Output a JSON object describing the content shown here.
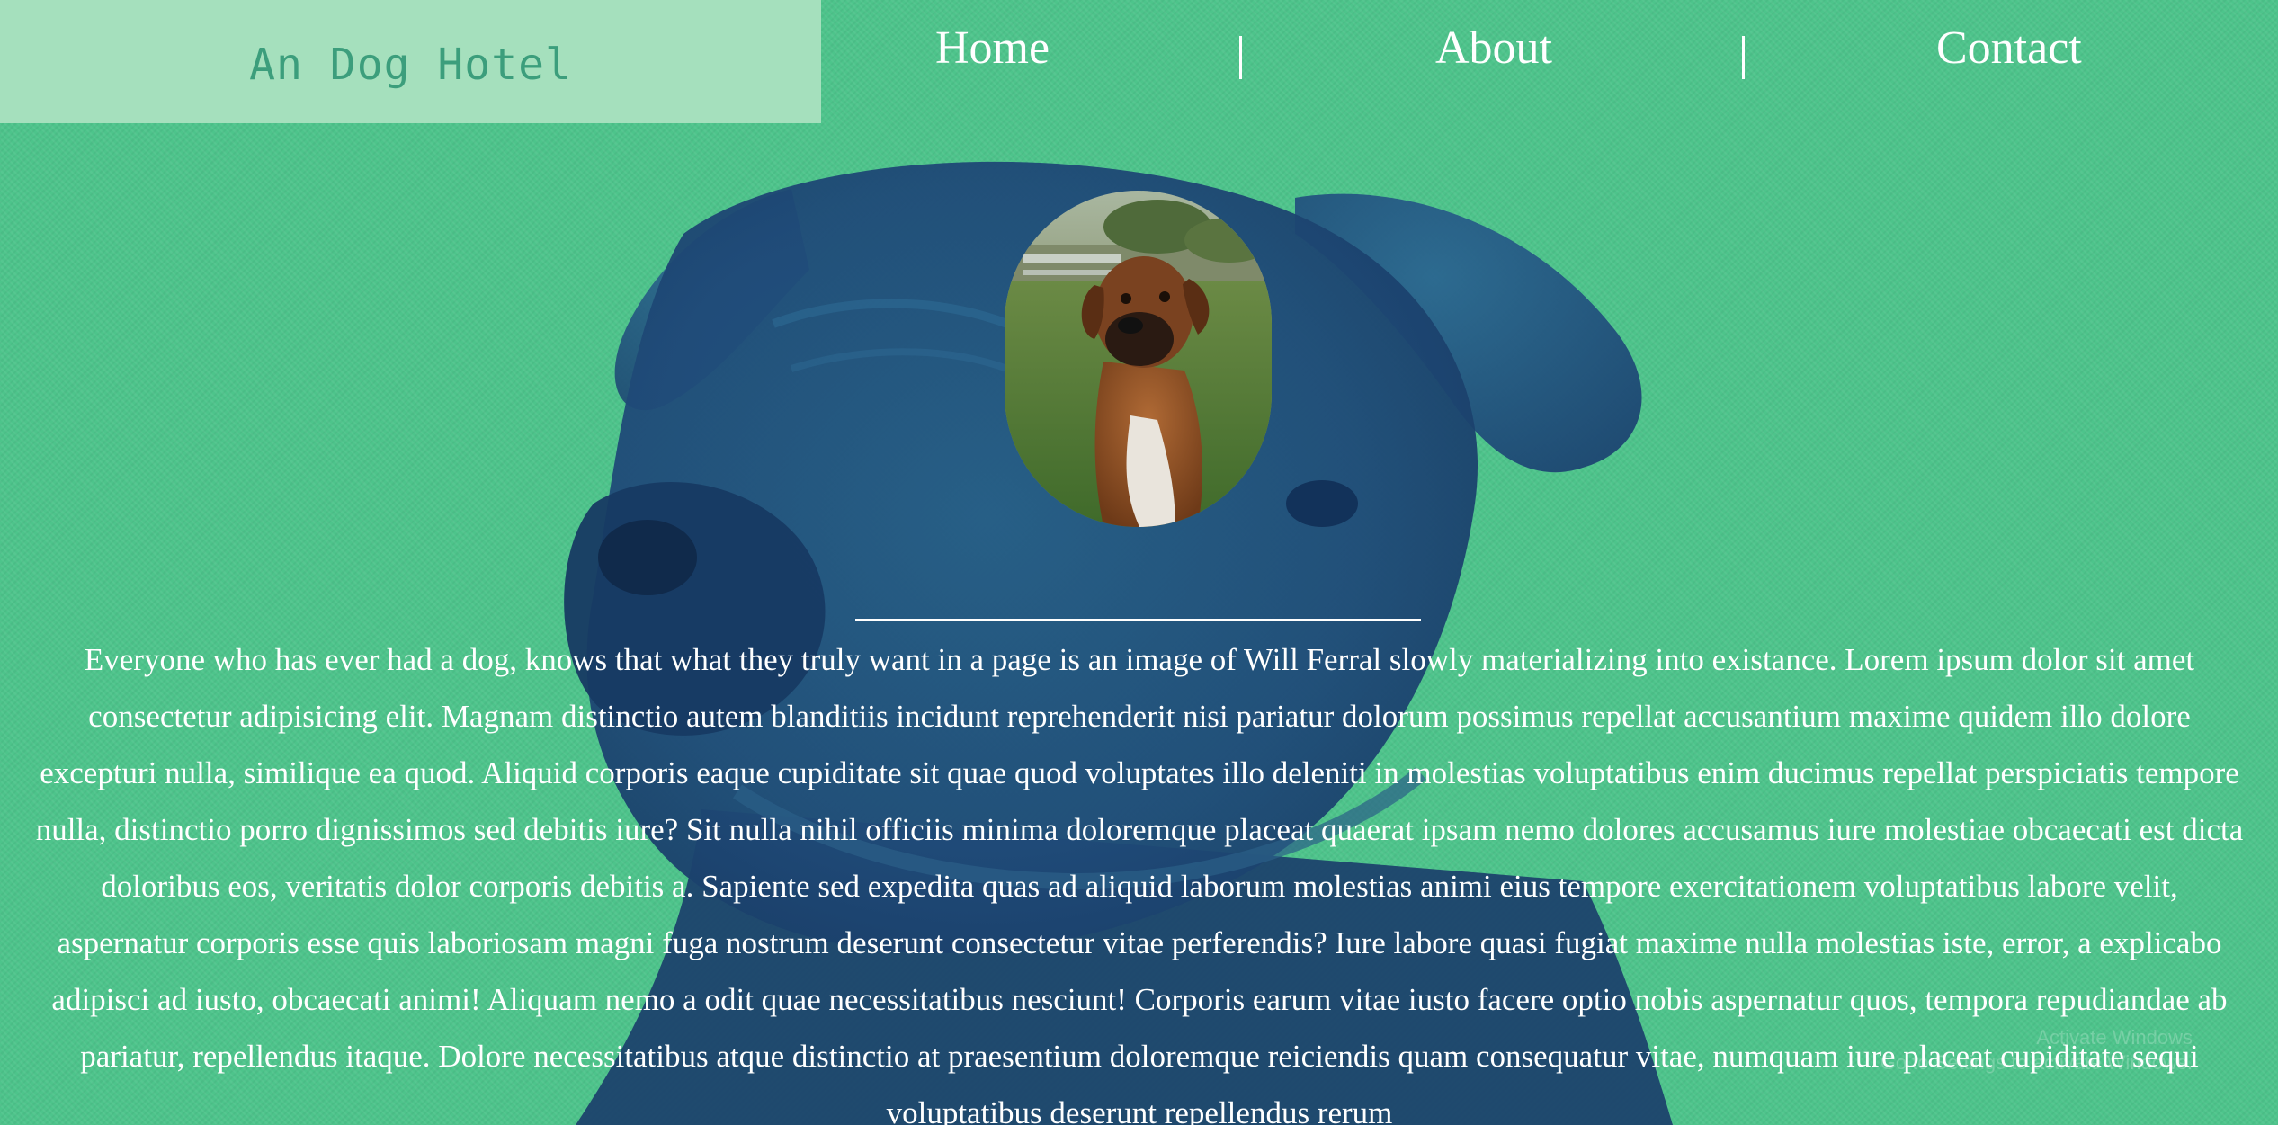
{
  "brand": {
    "name": "An Dog Hotel"
  },
  "nav": {
    "items": [
      {
        "label": "Home"
      },
      {
        "label": "About"
      },
      {
        "label": "Contact"
      }
    ]
  },
  "icons": {
    "background": "dog-silhouette-background-image",
    "portrait": "boxer-dog-photo"
  },
  "colors": {
    "background": "#4dc48b",
    "brand_panel": "#a5e0bd",
    "brand_text": "#3c9e7c",
    "dog_silhouette": "#1f4a78",
    "text": "#ffffff"
  },
  "content": {
    "paragraph": "Everyone who has ever had a dog, knows that what they truly want in a page is an image of Will Ferral slowly materializing into existance. Lorem ipsum dolor sit amet consectetur adipisicing elit. Magnam distinctio autem blanditiis incidunt reprehenderit nisi pariatur dolorum possimus repellat accusantium maxime quidem illo dolore excepturi nulla, similique ea quod. Aliquid corporis eaque cupiditate sit quae quod voluptates illo deleniti in molestias voluptatibus enim ducimus repellat perspiciatis tempore nulla, distinctio porro dignissimos sed debitis iure? Sit nulla nihil officiis minima doloremque placeat quaerat ipsam nemo dolores accusamus iure molestiae obcaecati est dicta doloribus eos, veritatis dolor corporis debitis a. Sapiente sed expedita quas ad aliquid laborum molestias animi eius tempore exercitationem voluptatibus labore velit, aspernatur corporis esse quis laboriosam magni fuga nostrum deserunt consectetur vitae perferendis? Iure labore quasi fugiat maxime nulla molestias iste, error, a explicabo adipisci ad iusto, obcaecati animi! Aliquam nemo a odit quae necessitatibus nesciunt! Corporis earum vitae iusto facere optio nobis aspernatur quos, tempora repudiandae ab pariatur, repellendus itaque. Dolore necessitatibus atque distinctio at praesentium doloremque reiciendis quam consequatur vitae, numquam iure placeat cupiditate sequi voluptatibus deserunt repellendus rerum"
  },
  "watermark": {
    "line1": "Activate Windows",
    "line2": "Go to Settings to activate Windows."
  }
}
